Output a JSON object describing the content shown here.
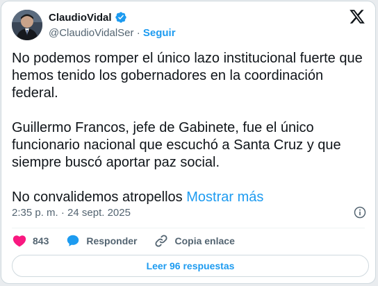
{
  "author": {
    "name": "ClaudioVidal",
    "handle": "@ClaudioVidalSer",
    "separator": " · ",
    "follow_label": "Seguir",
    "verified": true
  },
  "tweet": {
    "paragraphs": [
      "No podemos romper el único lazo institucional fuerte que hemos tenido los gobernadores en la coordinación federal.",
      "Guillermo Francos, jefe de Gabinete, fue el único funcionario nacional que escuchó a Santa Cruz y que siempre buscó aportar paz social.",
      "No convalidemos atropellos"
    ],
    "show_more_label": "Mostrar más",
    "timestamp": "2:35 p. m. · 24 sept. 2025"
  },
  "actions": {
    "like_count": "843",
    "reply_label": "Responder",
    "copy_link_label": "Copia enlace"
  },
  "read_replies_label": "Leer 96 respuestas",
  "colors": {
    "accent": "#1d9bf0",
    "like": "#f91880",
    "text": "#0f1419",
    "muted": "#536471"
  },
  "icons": [
    "verified-badge-icon",
    "x-logo-icon",
    "info-icon",
    "heart-icon",
    "reply-bubble-icon",
    "link-icon"
  ]
}
